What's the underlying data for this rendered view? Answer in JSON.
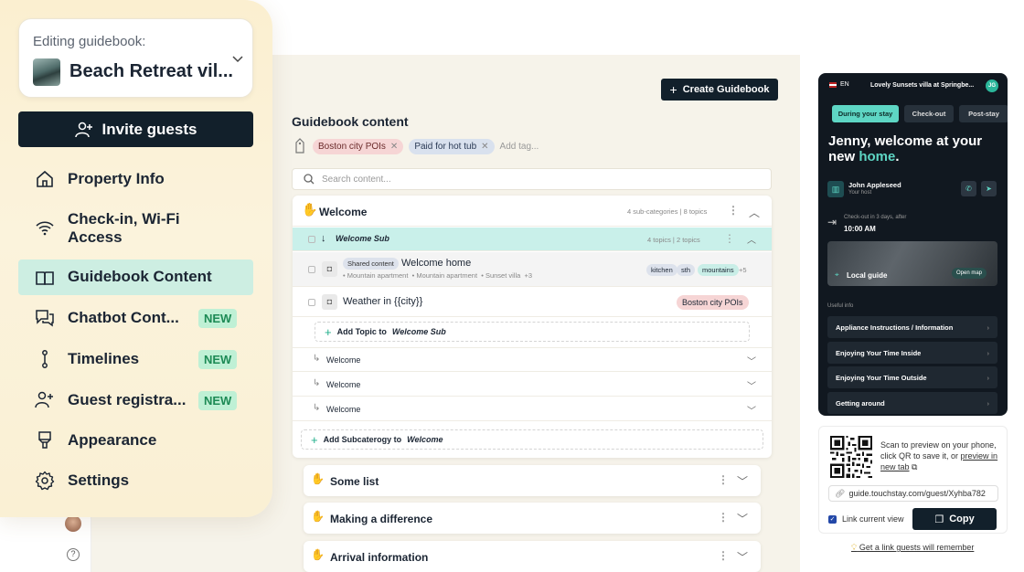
{
  "sidebar": {
    "caption": "Editing guidebook:",
    "property_name": "Beach Retreat vil...",
    "invite_label": "Invite guests",
    "items": [
      {
        "label": "Property Info",
        "icon": "home-icon"
      },
      {
        "label": "Check-in, Wi-Fi Access",
        "icon": "wifi-icon"
      },
      {
        "label": "Guidebook Content",
        "icon": "book-icon",
        "active": true
      },
      {
        "label": "Chatbot Cont...",
        "icon": "chat-icon",
        "badge": "NEW"
      },
      {
        "label": "Timelines",
        "icon": "timeline-icon",
        "badge": "NEW"
      },
      {
        "label": "Guest registra...",
        "icon": "user-plus-icon",
        "badge": "NEW"
      },
      {
        "label": "Appearance",
        "icon": "brush-icon"
      },
      {
        "label": "Settings",
        "icon": "gear-icon"
      }
    ]
  },
  "rail": {
    "help": "?"
  },
  "main": {
    "create_button": "Create Guidebook",
    "title": "Guidebook content",
    "tags": [
      "Boston city POIs",
      "Paid for hot tub"
    ],
    "tag_placeholder": "Add tag...",
    "search_placeholder": "Search content...",
    "welcome": {
      "title": "Welcome",
      "meta": "4 sub-categories | 8 topics",
      "sub": {
        "title": "Welcome Sub",
        "meta": "4 topics | 2 topics"
      },
      "topic1": {
        "badge": "Shared content",
        "title": "Welcome home",
        "locations": [
          "Mountain apartment",
          "Mountain apartment",
          "Sunset villa"
        ],
        "more": "+3",
        "tags": [
          "kitchen",
          "sth",
          "mountains"
        ],
        "tags_more": "+5"
      },
      "topic2": {
        "title": "Weather in {{city}}",
        "tag": "Boston city POIs"
      },
      "add_topic_prefix": "Add Topic to",
      "add_topic_target": "Welcome Sub",
      "subcategories": [
        "Welcome",
        "Welcome",
        "Welcome"
      ],
      "add_sub_prefix": "Add Subcaterogy to",
      "add_sub_target": "Welcome"
    },
    "categories": [
      "Some list",
      "Making a difference",
      "Arrival information"
    ]
  },
  "phone": {
    "lang": "EN",
    "property": "Lovely Sunsets villa at Springbe...",
    "avatar": "JG",
    "tabs": [
      "During your stay",
      "Check-out",
      "Post-stay"
    ],
    "greeting_main": "Jenny, welcome at your new",
    "greeting_accent": "home",
    "greeting_end": ".",
    "host_name": "John Appleseed",
    "host_role": "Your host",
    "checkout_caption": "Check-out in 3 days, after",
    "checkout_time": "10:00 AM",
    "local_guide": "Local guide",
    "open_map": "Open map",
    "useful_info": "Useful info",
    "info_items": [
      "Appliance Instructions / Information",
      "Enjoying Your Time Inside",
      "Enjoying Your Time Outside",
      "Getting around"
    ]
  },
  "share": {
    "qr_text_1": "Scan to preview on your phone, click QR to save it, or",
    "qr_link": "preview in new tab",
    "url": "guide.touchstay.com/guest/Xyhba782",
    "link_current": "Link current view",
    "copy": "Copy",
    "remember": "Get a link guests will remember"
  },
  "colors": {
    "accent": "#1fae8a",
    "dark": "#12202b",
    "sidebar_active": "#cdeee2",
    "badge_bg": "#bff0d5"
  }
}
